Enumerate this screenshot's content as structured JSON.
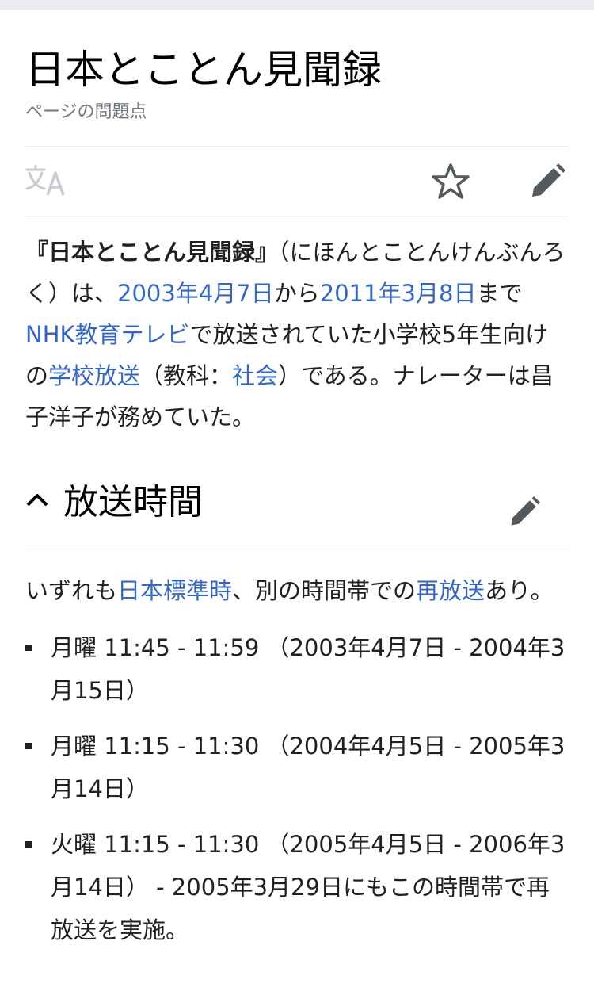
{
  "page": {
    "title": "日本とことん見聞録",
    "tagline": "ページの問題点"
  },
  "actions": {
    "language_icon": "translate-icon",
    "watch_icon": "star-icon",
    "edit_icon": "pencil-icon"
  },
  "lead": {
    "bold_title": "『日本とことん見聞録』",
    "t1": "（にほんとことんけんぶんろく）は、",
    "link_start_date": "2003年4月7日",
    "t2": "から",
    "link_end_date": "2011年3月8日",
    "t3": "まで",
    "link_nhk": "NHK教育テレビ",
    "t4": "で放送されていた小学校5年生向けの",
    "link_school": "学校放送",
    "t5": "（教科：",
    "link_subject": "社会",
    "t6": "）である。ナレーターは昌子洋子が務めていた。"
  },
  "section": {
    "title": "放送時間",
    "intro_t1": "いずれも",
    "intro_link_jst": "日本標準時",
    "intro_t2": "、別の時間帯での",
    "intro_link_rebroadcast": "再放送",
    "intro_t3": "あり。",
    "items": [
      "月曜 11:45 - 11:59 （2003年4月7日 - 2004年3月15日）",
      "月曜 11:15 - 11:30 （2004年4月5日 - 2005年3月14日）",
      "火曜 11:15 - 11:30 （2005年4月5日 - 2006年3月14日） - 2005年3月29日にもこの時間帯で再放送を実施。"
    ]
  },
  "colors": {
    "link": "#3366cc",
    "text": "#202122",
    "muted": "#72777d",
    "divider": "#c8ccd1"
  }
}
